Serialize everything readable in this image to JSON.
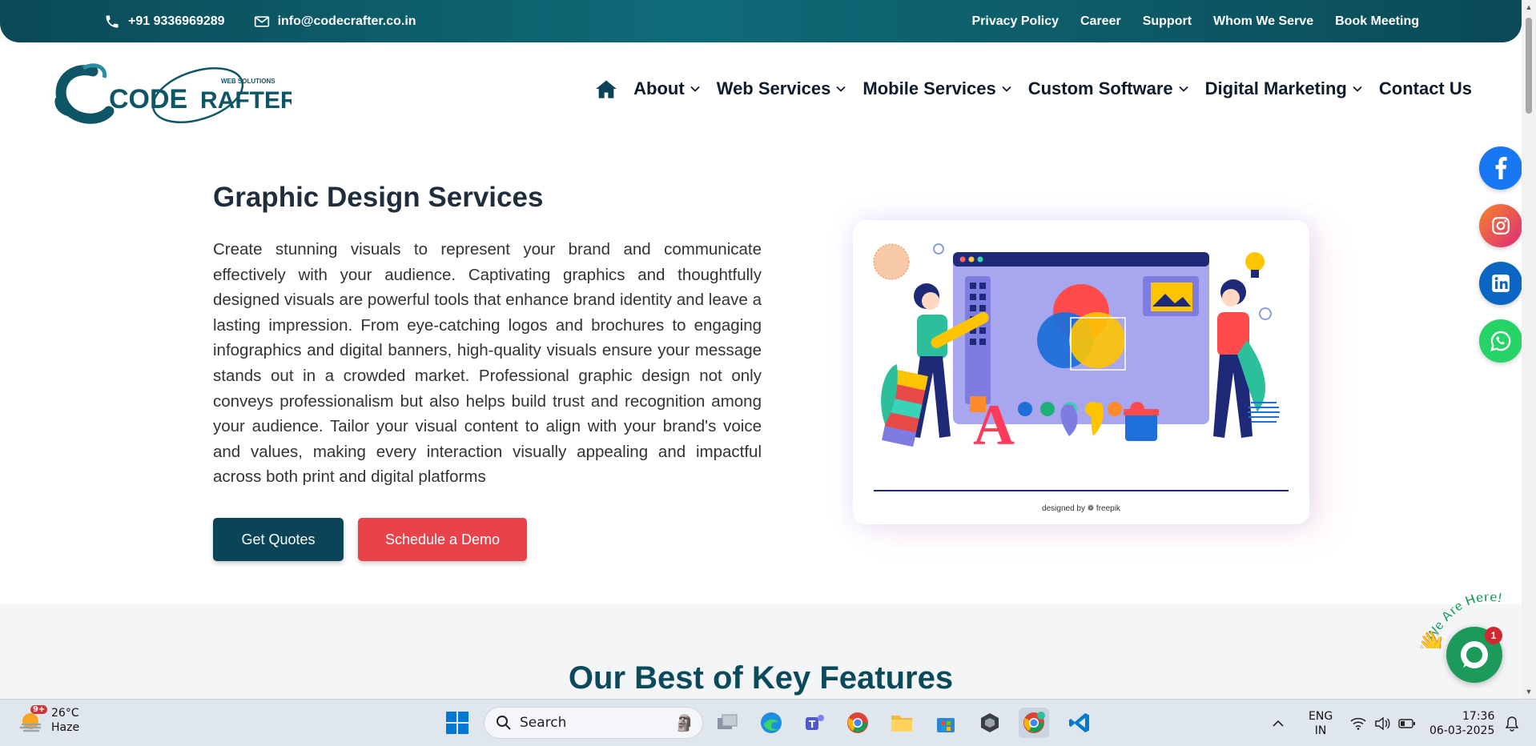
{
  "topbar": {
    "phone": "+91 9336969289",
    "email": "info@codecrafter.co.in",
    "links": [
      "Privacy Policy",
      "Career",
      "Support",
      "Whom We Serve",
      "Book Meeting"
    ]
  },
  "logo": {
    "text_main": "CODE",
    "text_second": "RAFTER",
    "tagline": "WEB SOLUTIONS"
  },
  "nav": {
    "home_icon": "home-icon",
    "items": [
      {
        "label": "About",
        "dropdown": true
      },
      {
        "label": "Web Services",
        "dropdown": true
      },
      {
        "label": "Mobile Services",
        "dropdown": true
      },
      {
        "label": "Custom Software",
        "dropdown": true
      },
      {
        "label": "Digital Marketing",
        "dropdown": true
      },
      {
        "label": "Contact Us",
        "dropdown": false
      }
    ]
  },
  "hero": {
    "title": "Graphic Design Services",
    "body": "Create stunning visuals to represent your brand and communicate effectively with your audience. Captivating graphics and thoughtfully designed visuals are powerful tools that enhance brand identity and leave a lasting impression. From eye-catching logos and brochures to engaging infographics and digital banners, high-quality visuals ensure your message stands out in a crowded market. Professional graphic design not only conveys professionalism but also helps build trust and recognition among your audience. Tailor your visual content to align with your brand's voice and values, making every interaction visually appealing and impactful across both print and digital platforms",
    "primary_button": "Get Quotes",
    "secondary_button": "Schedule a Demo",
    "image_credit": "designed by ❁ freepik",
    "illustration_letter": "A"
  },
  "features": {
    "title": "Our Best of Key Features"
  },
  "social": [
    "facebook-icon",
    "instagram-icon",
    "linkedin-icon",
    "whatsapp-icon"
  ],
  "chat": {
    "badge": "1",
    "banner": "We Are Here!"
  },
  "colors": {
    "brand": "#0b4a57",
    "accent": "#e8434b",
    "dark_button": "#0b4457"
  },
  "taskbar": {
    "weather_temp": "26°C",
    "weather_desc": "Haze",
    "weather_badge": "9+",
    "search_placeholder": "Search",
    "lang_top": "ENG",
    "lang_bottom": "IN",
    "time": "17:36",
    "date": "06-03-2025"
  }
}
